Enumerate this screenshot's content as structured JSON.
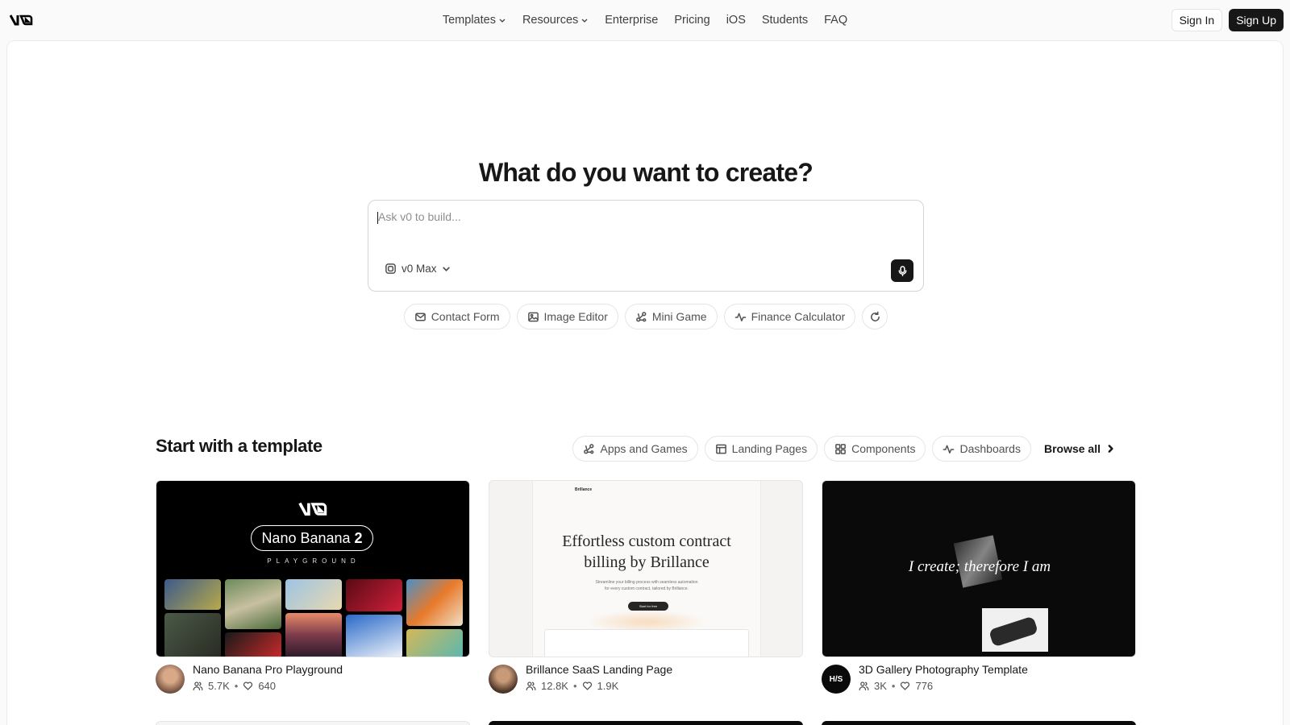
{
  "nav": {
    "links": [
      {
        "label": "Templates",
        "dropdown": true
      },
      {
        "label": "Resources",
        "dropdown": true
      },
      {
        "label": "Enterprise",
        "dropdown": false
      },
      {
        "label": "Pricing",
        "dropdown": false
      },
      {
        "label": "iOS",
        "dropdown": false
      },
      {
        "label": "Students",
        "dropdown": false
      },
      {
        "label": "FAQ",
        "dropdown": false
      }
    ],
    "sign_in": "Sign In",
    "sign_up": "Sign Up"
  },
  "hero": {
    "title": "What do you want to create?",
    "placeholder": "Ask v0 to build...",
    "model": "v0 Max",
    "suggestions": [
      {
        "label": "Contact Form",
        "icon": "mail-icon"
      },
      {
        "label": "Image Editor",
        "icon": "image-icon"
      },
      {
        "label": "Mini Game",
        "icon": "nodes-icon"
      },
      {
        "label": "Finance Calculator",
        "icon": "activity-icon"
      }
    ]
  },
  "templates": {
    "title": "Start with a template",
    "filters": [
      {
        "label": "Apps and Games",
        "icon": "nodes-icon"
      },
      {
        "label": "Landing Pages",
        "icon": "layout-icon"
      },
      {
        "label": "Components",
        "icon": "grid-icon"
      },
      {
        "label": "Dashboards",
        "icon": "activity-icon"
      }
    ],
    "browse_all": "Browse all",
    "cards": [
      {
        "title": "Nano Banana Pro Playground",
        "users": "5.7K",
        "likes": "640",
        "thumb_text": {
          "badge": "Nano Banana",
          "badge_num": "2",
          "sub": "PLAYGROUND"
        }
      },
      {
        "title": "Brillance SaaS Landing Page",
        "users": "12.8K",
        "likes": "1.9K",
        "thumb_text": {
          "brand": "Brillance",
          "headline_1": "Effortless custom contract",
          "headline_2": "billing by Brillance",
          "sub_1": "Streamline your billing process with seamless automation",
          "sub_2": "for every custom contract, tailored by Brillance.",
          "cta": "Start for free"
        }
      },
      {
        "title": "3D Gallery Photography Template",
        "users": "3K",
        "likes": "776",
        "avatar_text": "H/S",
        "thumb_text": {
          "quote": "I create; therefore I am"
        }
      }
    ]
  },
  "colors": {
    "accent": "#171717",
    "muted": "#525252",
    "border": "#e5e5e5"
  }
}
